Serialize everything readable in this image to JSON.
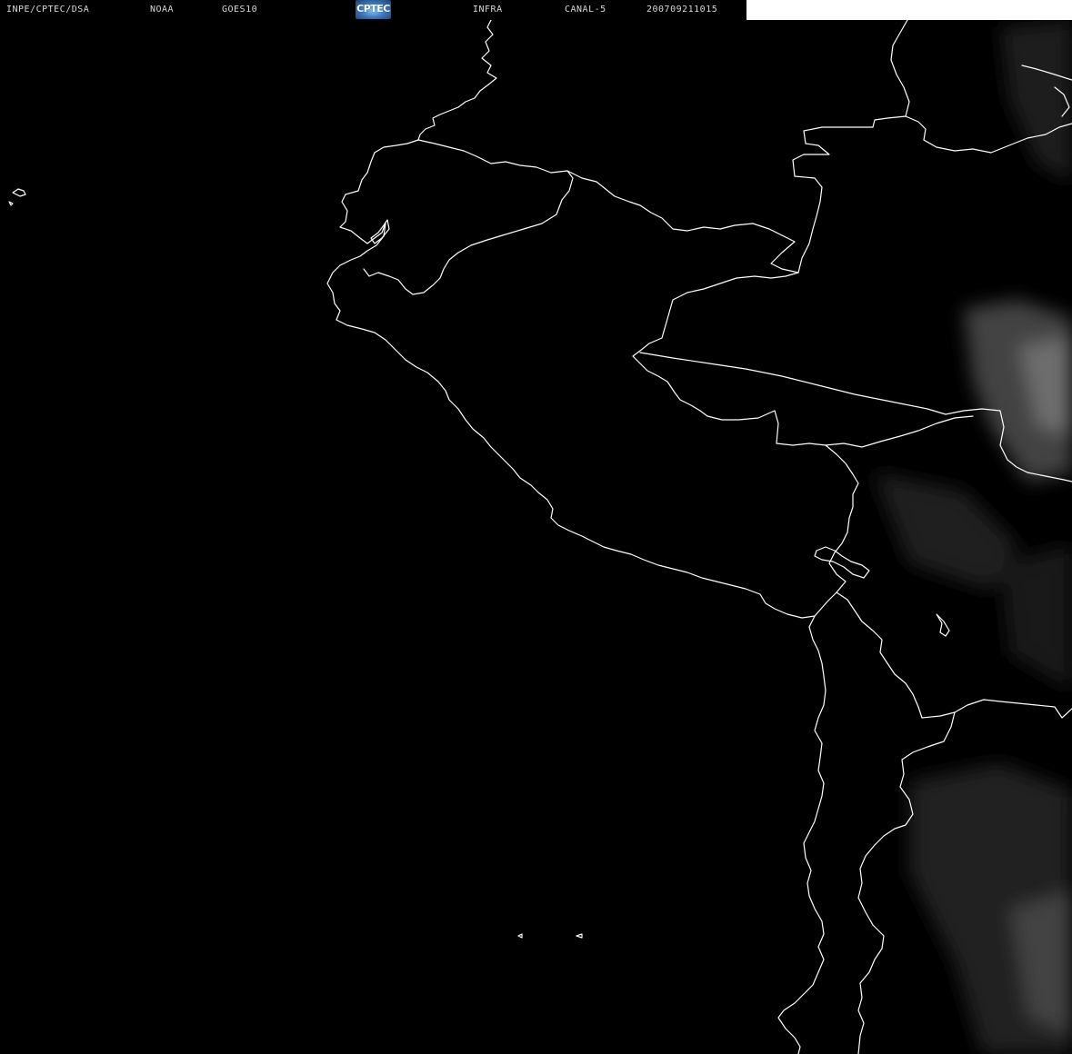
{
  "header": {
    "institution": "INPE/CPTEC/DSA",
    "agency": "NOAA",
    "satellite": "GOES10",
    "logo": "CPTEC",
    "band": "INFRA",
    "channel": "CANAL-5",
    "timestamp": "200709211015"
  },
  "colors": {
    "background": "#000000",
    "coastline": "#ffffff",
    "cloud": "#6a6a6a",
    "header_text": "#d8d8d8",
    "header_band": "#ffffff"
  }
}
